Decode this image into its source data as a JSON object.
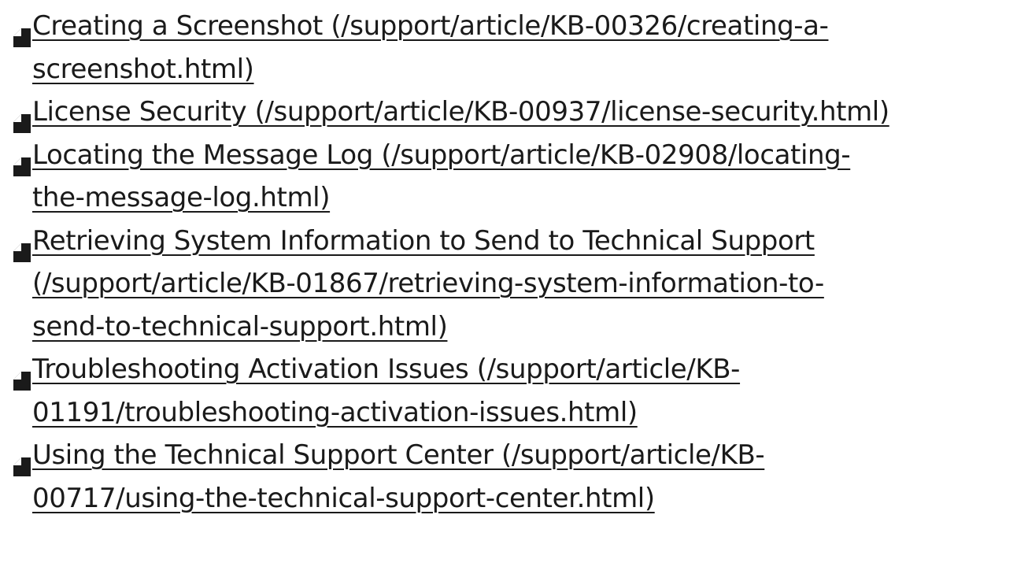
{
  "articles": [
    {
      "lines": [
        "Creating a Screenshot (/support/article/KB-00326/creating-a-",
        "screenshot.html)"
      ],
      "icon": "document-icon"
    },
    {
      "lines": [
        "License Security (/support/article/KB-00937/license-security.html)"
      ],
      "icon": "document-icon"
    },
    {
      "lines": [
        "Locating the Message Log (/support/article/KB-02908/locating-",
        "the-message-log.html)"
      ],
      "icon": "document-icon"
    },
    {
      "lines": [
        "Retrieving System Information to Send to Technical Support",
        "(/support/article/KB-01867/retrieving-system-information-to-",
        "send-to-technical-support.html)"
      ],
      "icon": "document-icon"
    },
    {
      "lines": [
        "Troubleshooting Activation Issues (/support/article/KB-",
        "01191/troubleshooting-activation-issues.html)"
      ],
      "icon": "document-icon"
    },
    {
      "lines": [
        "Using the Technical Support Center (/support/article/KB-",
        "00717/using-the-technical-support-center.html)"
      ],
      "icon": "document-icon"
    }
  ],
  "colors": {
    "text": "#1a1a1a",
    "background": "#ffffff"
  }
}
